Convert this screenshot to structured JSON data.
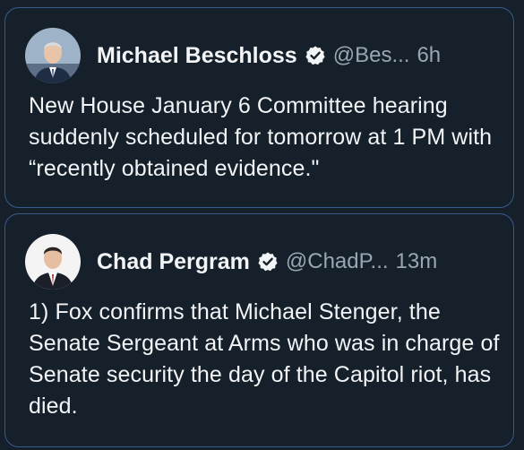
{
  "tweets": [
    {
      "name": "Michael Beschloss",
      "handle": "@Bes...",
      "time": "6h",
      "text": "New House January 6 Committee hearing suddenly scheduled for tomorrow at 1 PM with “recently obtained evidence.\""
    },
    {
      "name": "Chad Pergram",
      "handle": "@ChadP...",
      "time": "13m",
      "text": "1) Fox confirms that Michael Stenger, the Senate Sergeant at Arms who was in charge of Senate security the day of the Capitol riot, has died."
    }
  ],
  "icons": {
    "verified": "verified-badge-icon",
    "avatar1": "avatar",
    "avatar2": "avatar"
  },
  "colors": {
    "background": "#15202b",
    "border": "#3a5a8c",
    "text": "#f2f4f6",
    "muted": "#9aa6b3"
  }
}
